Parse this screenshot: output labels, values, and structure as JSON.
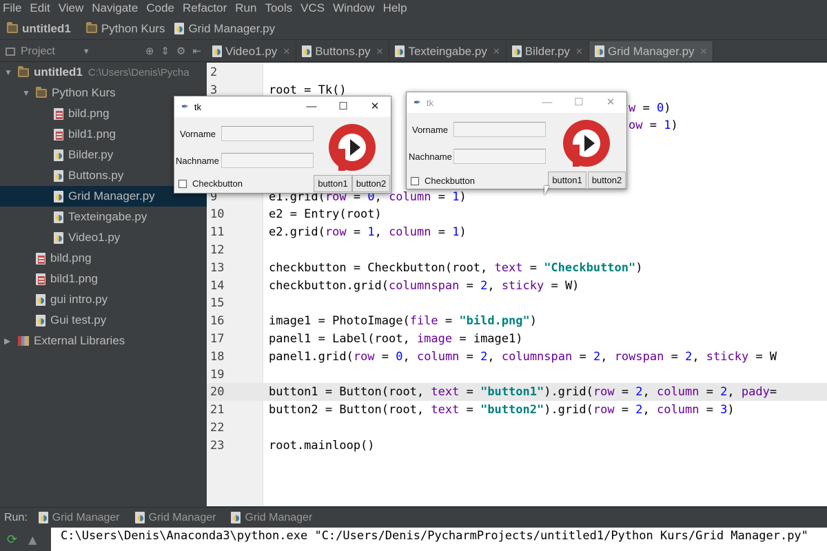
{
  "menu": [
    "File",
    "Edit",
    "View",
    "Navigate",
    "Code",
    "Refactor",
    "Run",
    "Tools",
    "VCS",
    "Window",
    "Help"
  ],
  "breadcrumb": [
    "untitled1",
    "Python Kurs",
    "Grid Manager.py"
  ],
  "project_header": {
    "label": "Project"
  },
  "tabs": [
    {
      "label": "Video1.py",
      "active": false
    },
    {
      "label": "Buttons.py",
      "active": false
    },
    {
      "label": "Texteingabe.py",
      "active": false
    },
    {
      "label": "Bilder.py",
      "active": false
    },
    {
      "label": "Grid Manager.py",
      "active": true
    }
  ],
  "tree": [
    {
      "label": "untitled1",
      "path": "C:\\Users\\Denis\\Pycha",
      "type": "folder",
      "depth": 0,
      "arrow": "open",
      "bold": true
    },
    {
      "label": "Python Kurs",
      "type": "folder",
      "depth": 1,
      "arrow": "open"
    },
    {
      "label": "bild.png",
      "type": "png",
      "depth": 2
    },
    {
      "label": "bild1.png",
      "type": "png",
      "depth": 2
    },
    {
      "label": "Bilder.py",
      "type": "py",
      "depth": 2
    },
    {
      "label": "Buttons.py",
      "type": "py",
      "depth": 2
    },
    {
      "label": "Grid Manager.py",
      "type": "py",
      "depth": 2,
      "selected": true
    },
    {
      "label": "Texteingabe.py",
      "type": "py",
      "depth": 2
    },
    {
      "label": "Video1.py",
      "type": "py",
      "depth": 2
    },
    {
      "label": "bild.png",
      "type": "png",
      "depth": 1
    },
    {
      "label": "bild1.png",
      "type": "png",
      "depth": 1
    },
    {
      "label": "gui intro.py",
      "type": "py",
      "depth": 1
    },
    {
      "label": "Gui test.py",
      "type": "py",
      "depth": 1
    },
    {
      "label": "External Libraries",
      "type": "libs",
      "depth": 0,
      "arrow": "closed"
    }
  ],
  "code_lines": [
    {
      "n": "2",
      "html": ""
    },
    {
      "n": "3",
      "html": "root = Tk()"
    },
    {
      "n": "4",
      "html": "                                                   <span class='kw'>w</span> = <span class='num'>0</span>)"
    },
    {
      "n": "5",
      "html": "                                                   <span class='kw'>ow</span> = <span class='num'>1</span>)"
    },
    {
      "n": "6",
      "html": ""
    },
    {
      "n": "7",
      "html": ""
    },
    {
      "n": "8",
      "html": ""
    },
    {
      "n": "9",
      "html": "e1.grid(<span class='kw'>row</span> = <span class='num'>0</span>, <span class='kw'>column</span> = <span class='num'>1</span>)"
    },
    {
      "n": "10",
      "html": "e2 = Entry(root)"
    },
    {
      "n": "11",
      "html": "e2.grid(<span class='kw'>row</span> = <span class='num'>1</span>, <span class='kw'>column</span> = <span class='num'>1</span>)"
    },
    {
      "n": "12",
      "html": ""
    },
    {
      "n": "13",
      "html": "checkbutton = Checkbutton(root, <span class='kw'>text</span> = <span class='str'>\"Checkbutton\"</span>)"
    },
    {
      "n": "14",
      "html": "checkbutton.grid(<span class='kw'>columnspan</span> = <span class='num'>2</span>, <span class='kw'>sticky</span> = W)"
    },
    {
      "n": "15",
      "html": ""
    },
    {
      "n": "16",
      "html": "image1 = PhotoImage(<span class='kw'>file</span> = <span class='str'>\"bild.png\"</span>)"
    },
    {
      "n": "17",
      "html": "panel1 = Label(root, <span class='kw'>image</span> = image1)"
    },
    {
      "n": "18",
      "html": "panel1.grid(<span class='kw'>row</span> = <span class='num'>0</span>, <span class='kw'>column</span> = <span class='num'>2</span>, <span class='kw'>columnspan</span> = <span class='num'>2</span>, <span class='kw'>rowspan</span> = <span class='num'>2</span>, <span class='kw'>sticky</span> = W"
    },
    {
      "n": "19",
      "html": ""
    },
    {
      "n": "20",
      "html": "button1 = Button(root, <span class='kw'>text</span> = <span class='str'>\"button1\"</span>).grid(<span class='kw'>row</span> = <span class='num'>2</span>, <span class='kw'>column</span> = <span class='num'>2</span>, <span class='kw'>pady</span>=",
      "current": true
    },
    {
      "n": "21",
      "html": "button2 = Button(root, <span class='kw'>text</span> = <span class='str'>\"button2\"</span>).grid(<span class='kw'>row</span> = <span class='num'>2</span>, <span class='kw'>column</span> = <span class='num'>3</span>)"
    },
    {
      "n": "22",
      "html": ""
    },
    {
      "n": "23",
      "html": "root.mainloop()"
    }
  ],
  "tkwin1": {
    "title": "tk",
    "label_vorname": "Vorname",
    "label_nachname": "Nachname",
    "check_label": "Checkbutton",
    "button1": "button1",
    "button2": "button2"
  },
  "tkwin2": {
    "title": "tk",
    "label_vorname": "Vorname",
    "label_nachname": "Nachname",
    "check_label": "Checkbutton",
    "button1": "button1",
    "button2": "button2"
  },
  "run": {
    "label": "Run:",
    "tabs": [
      "Grid Manager",
      "Grid Manager",
      "Grid Manager"
    ]
  },
  "console": {
    "text": "C:\\Users\\Denis\\Anaconda3\\python.exe \"C:/Users/Denis/PycharmProjects/untitled1/Python Kurs/Grid Manager.py\""
  },
  "colors": {
    "ide_bg": "#3c3f41",
    "editor_bg": "#ffffff",
    "keyword": "#660099",
    "number": "#0000ff",
    "string": "#008080",
    "logo_red": "#d32f2f"
  }
}
